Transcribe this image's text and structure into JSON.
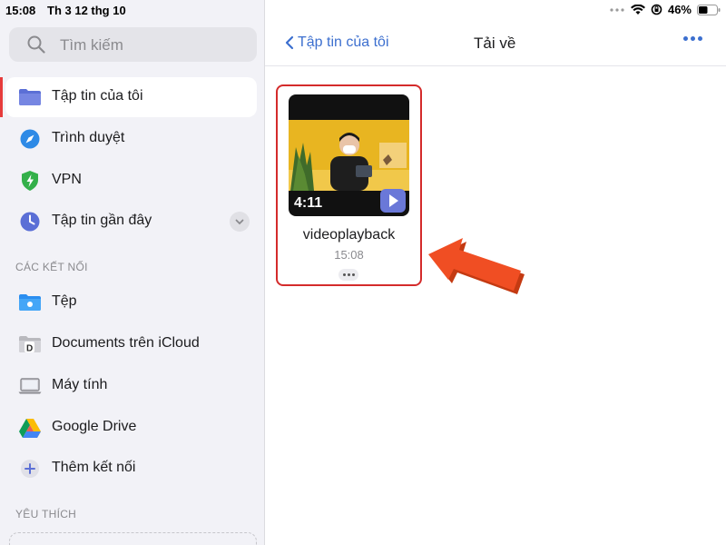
{
  "status_bar": {
    "time": "15:08",
    "date": "Th 3 12 thg 10",
    "battery_percent": "46%",
    "icons": [
      "ellipsis-icon",
      "wifi-icon",
      "rotation-lock-icon",
      "battery-icon"
    ]
  },
  "sidebar": {
    "search": {
      "placeholder": "Tìm kiếm"
    },
    "items": [
      {
        "label": "Tập tin của tôi",
        "icon": "folder-icon",
        "active": true
      },
      {
        "label": "Trình duyệt",
        "icon": "compass-icon"
      },
      {
        "label": "VPN",
        "icon": "shield-icon"
      },
      {
        "label": "Tập tin gần đây",
        "icon": "clock-icon"
      }
    ],
    "connections_header": "CÁC KẾT NỐI",
    "connections": [
      {
        "label": "Tệp",
        "icon": "files-folder-icon"
      },
      {
        "label": "Documents trên iCloud",
        "icon": "documents-icon"
      },
      {
        "label": "Máy tính",
        "icon": "laptop-icon"
      },
      {
        "label": "Google Drive",
        "icon": "google-drive-icon"
      },
      {
        "label": "Thêm kết nối",
        "icon": "plus-icon"
      }
    ],
    "favorites_header": "YÊU THÍCH"
  },
  "main": {
    "back_label": "Tập tin của tôi",
    "title": "Tải về",
    "files": [
      {
        "name": "videoplayback",
        "time": "15:08",
        "duration": "4:11"
      }
    ]
  },
  "colors": {
    "accent": "#3c6fcf",
    "highlight_red": "#d42b2b",
    "arrow_orange": "#f04e23"
  }
}
